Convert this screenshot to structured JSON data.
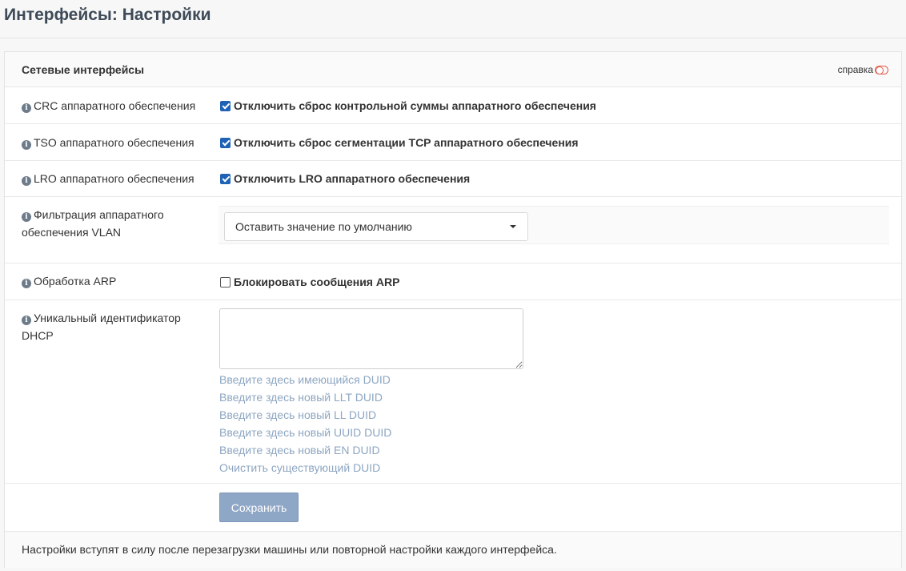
{
  "page": {
    "title": "Интерфейсы: Настройки"
  },
  "section": {
    "title": "Сетевые интерфейсы",
    "help_label": "справка"
  },
  "rows": {
    "crc": {
      "label": "CRC аппаратного обеспечения",
      "checkbox_label": "Отключить сброс контрольной суммы аппаратного обеспечения",
      "checked": true
    },
    "tso": {
      "label": "TSO аппаратного обеспечения",
      "checkbox_label": "Отключить сброс сегментации TCP аппаратного обеспечения",
      "checked": true
    },
    "lro": {
      "label": "LRO аппаратного обеспечения",
      "checkbox_label": "Отключить LRO аппаратного обеспечения",
      "checked": true
    },
    "vlan": {
      "label": "Фильтрация аппаратного обеспечения VLAN",
      "selected": "Оставить значение по умолчанию"
    },
    "arp": {
      "label": "Обработка ARP",
      "checkbox_label": "Блокировать сообщения ARP",
      "checked": false
    },
    "duid": {
      "label": "Уникальный идентификатор DHCP",
      "value": "",
      "links": [
        "Введите здесь имеющийся DUID",
        "Введите здесь новый LLT DUID",
        "Введите здесь новый LL DUID",
        "Введите здесь новый UUID DUID",
        "Введите здесь новый EN DUID",
        "Очистить существующий DUID"
      ]
    }
  },
  "actions": {
    "save_label": "Сохранить"
  },
  "footer": {
    "note": "Настройки вступят в силу после перезагрузки машины или повторной настройки каждого интерфейса."
  },
  "colors": {
    "accent": "#1e63b5",
    "title": "#3e4a57",
    "link": "#8da6c2",
    "save_button": "#8fa7c6",
    "help_toggle": "#e35b4b"
  },
  "icons": {
    "info": "info-circle-icon",
    "help": "toggle-icon",
    "select": "caret-down-icon"
  }
}
